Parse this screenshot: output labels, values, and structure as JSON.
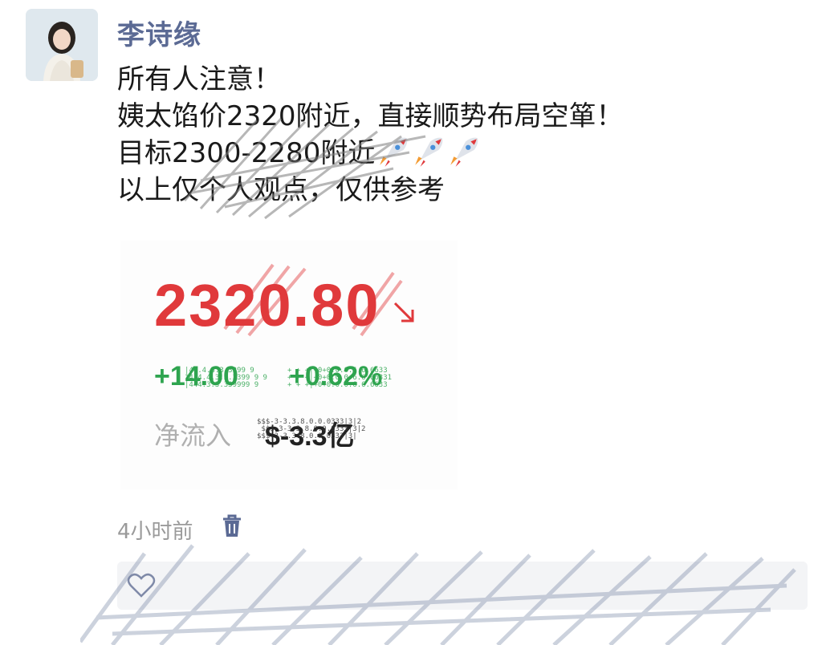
{
  "post": {
    "author": "李诗缘",
    "lines": [
      "所有人注意！",
      "姨太馅价2320附近，直接顺势布局空箪！",
      "目标2300-2280附近",
      "以上仅个人观点，仅供参考"
    ],
    "rocket_icons": [
      "rocket-icon",
      "rocket-icon",
      "rocket-icon"
    ]
  },
  "quote": {
    "price": "2320.80",
    "trend_icon": "arrow-down-right-icon",
    "change": "+14.00",
    "change_pct": "+0.62%",
    "netflow_label": "净流入",
    "netflow_value": "$-3.3亿",
    "price_color": "#e0393b",
    "change_color": "#2ea44f"
  },
  "meta": {
    "time_ago": "4小时前",
    "delete_icon": "trash-icon"
  },
  "actions": {
    "like_icon": "heart-icon"
  },
  "colors": {
    "author": "#5b6a94",
    "muted": "#9a9a9a"
  }
}
